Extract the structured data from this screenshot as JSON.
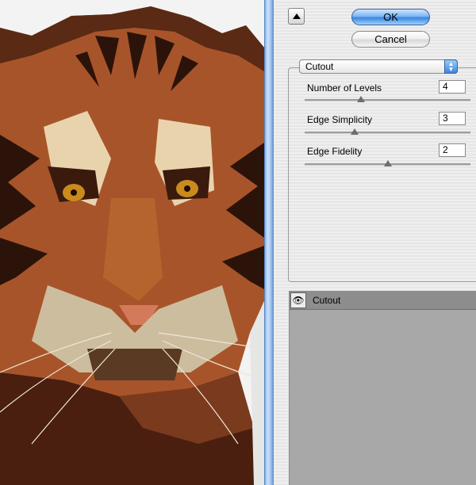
{
  "dialog": {
    "ok_label": "OK",
    "cancel_label": "Cancel",
    "collapse_icon": "triangle-up-icon"
  },
  "filter": {
    "selected": "Cutout",
    "selector_icon": "up-down-arrows-icon",
    "params": [
      {
        "label": "Number of Levels",
        "value": "4",
        "slider_fraction": 0.34
      },
      {
        "label": "Edge Simplicity",
        "value": "3",
        "slider_fraction": 0.3
      },
      {
        "label": "Edge Fidelity",
        "value": "2",
        "slider_fraction": 0.5
      }
    ]
  },
  "layers": {
    "items": [
      {
        "name": "Cutout",
        "visible_icon": "eye-icon"
      }
    ]
  },
  "preview": {
    "subject": "tiger-cutout-preview"
  },
  "colors": {
    "accent": "#3a86e0",
    "panel_bg": "#ececec",
    "layer_bg": "#a8a8a8"
  }
}
